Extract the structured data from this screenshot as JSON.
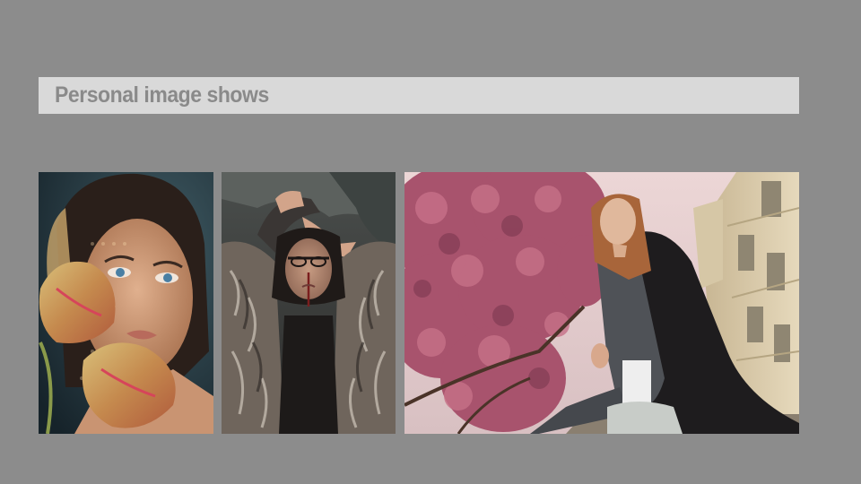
{
  "slide": {
    "title": "Personal image shows"
  },
  "gallery": {
    "photos": [
      {
        "name": "portrait-with-flowers"
      },
      {
        "name": "portrait-in-fur-coat"
      },
      {
        "name": "woman-under-cherry-blossoms"
      }
    ]
  },
  "colors": {
    "background": "#8c8c8c",
    "title_bar": "#d9d9d9",
    "title_text": "#8a8a8a"
  }
}
